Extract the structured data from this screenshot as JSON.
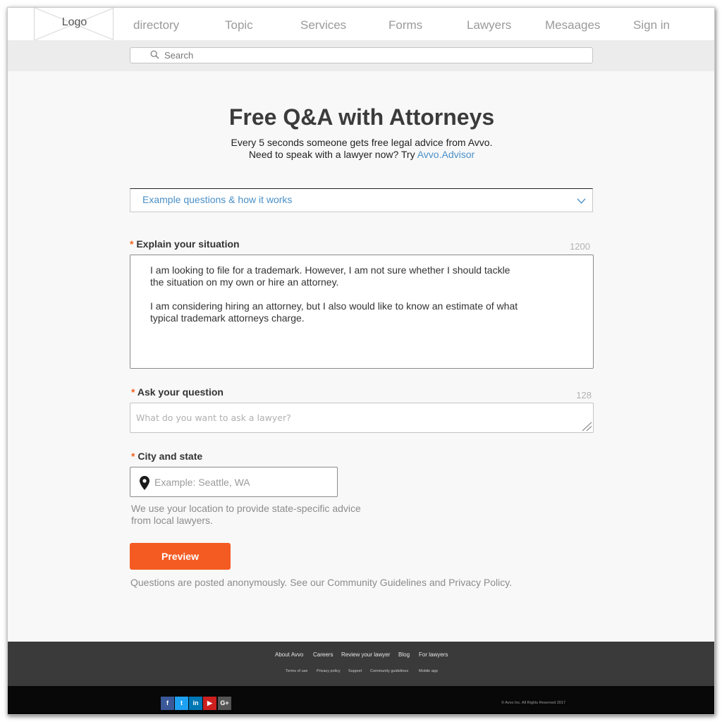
{
  "header": {
    "logo_text": "Logo",
    "nav": [
      "directory",
      "Topic",
      "Services",
      "Forms",
      "Lawyers",
      "Mesaages",
      "Sign in"
    ]
  },
  "search": {
    "placeholder": "Search"
  },
  "hero": {
    "title": "Free Q&A with Attorneys",
    "line1": "Every 5 seconds someone gets free legal advice from Avvo.",
    "line2_prefix": "Need to speak with a lawyer now? Try ",
    "line2_link": "Avvo.Advisor"
  },
  "accordion": {
    "label": "Example questions & how it works"
  },
  "form": {
    "required_mark": "*",
    "situation": {
      "label": "Explain your situation",
      "count": "1200",
      "paragraph1": "I am looking to file for a trademark. However, I am not sure whether I should tackle\nthe situation on my own or hire an attorney.",
      "paragraph2": "I am considering hiring an attorney, but I also would like to know an estimate of what\ntypical trademark attorneys charge."
    },
    "question": {
      "label": "Ask your question",
      "count": "128",
      "placeholder": "What do you want to ask a lawyer?"
    },
    "city": {
      "label": "City and state",
      "placeholder": "Example: Seattle, WA",
      "help_line1": "We use your location to provide state-specific advice",
      "help_line2": "from local lawyers."
    },
    "preview_label": "Preview",
    "disclaimer": "Questions are posted anonymously. See our Community Guidelines and Privacy Policy."
  },
  "footer": {
    "links": [
      "About Avvo",
      "Careers",
      "Review your lawyer",
      "Blog",
      "For lawyers"
    ],
    "sublinks": [
      "Terms of use",
      "Privacy policy",
      "Support",
      "Community guidelines",
      "Mobile app"
    ],
    "social": [
      {
        "icon": "facebook-icon",
        "glyph": "f",
        "color": "#3b5998"
      },
      {
        "icon": "twitter-icon",
        "glyph": "t",
        "color": "#1da1f2"
      },
      {
        "icon": "linkedin-icon",
        "glyph": "in",
        "color": "#0077b5"
      },
      {
        "icon": "youtube-icon",
        "glyph": "▶",
        "color": "#cd201f"
      },
      {
        "icon": "google-plus-icon",
        "glyph": "G+",
        "color": "#555555"
      }
    ],
    "copyright": "© Avvo Inc. All Rights Reserved 2017"
  },
  "colors": {
    "accent_orange": "#f45b22",
    "link_blue": "#4a90c8",
    "footer_dark": "#3a3a3a",
    "footer_black": "#080808"
  }
}
